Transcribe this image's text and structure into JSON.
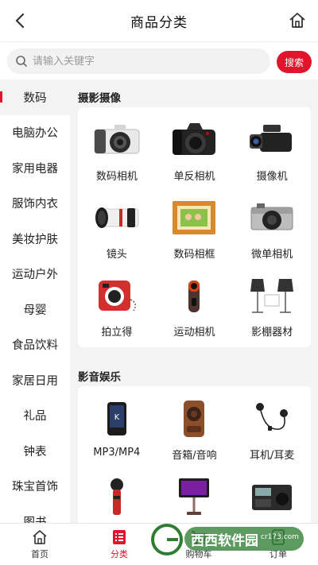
{
  "header": {
    "title": "商品分类"
  },
  "search": {
    "placeholder": "请输入关键字",
    "button": "搜索"
  },
  "sidebar": {
    "items": [
      {
        "label": "数码",
        "active": true
      },
      {
        "label": "电脑办公"
      },
      {
        "label": "家用电器"
      },
      {
        "label": "服饰内衣"
      },
      {
        "label": "美妆护肤"
      },
      {
        "label": "运动户外"
      },
      {
        "label": "母婴"
      },
      {
        "label": "食品饮料"
      },
      {
        "label": "家居日用"
      },
      {
        "label": "礼品"
      },
      {
        "label": "钟表"
      },
      {
        "label": "珠宝首饰"
      },
      {
        "label": "图书"
      }
    ]
  },
  "sections": [
    {
      "title": "摄影摄像",
      "items": [
        {
          "label": "数码相机",
          "icon": "mirrorless-camera-icon"
        },
        {
          "label": "单反相机",
          "icon": "dslr-camera-icon"
        },
        {
          "label": "摄像机",
          "icon": "camcorder-icon"
        },
        {
          "label": "镜头",
          "icon": "lens-icon"
        },
        {
          "label": "数码相框",
          "icon": "photo-frame-icon"
        },
        {
          "label": "微单相机",
          "icon": "micro-camera-icon"
        },
        {
          "label": "拍立得",
          "icon": "instant-camera-icon"
        },
        {
          "label": "运动相机",
          "icon": "action-camera-icon"
        },
        {
          "label": "影棚器材",
          "icon": "studio-light-icon"
        }
      ]
    },
    {
      "title": "影音娱乐",
      "items": [
        {
          "label": "MP3/MP4",
          "icon": "mp3-player-icon"
        },
        {
          "label": "音箱/音响",
          "icon": "speaker-icon"
        },
        {
          "label": "耳机/耳麦",
          "icon": "earphones-icon"
        },
        {
          "label": "",
          "icon": "microphone-icon"
        },
        {
          "label": "",
          "icon": "karaoke-machine-icon"
        },
        {
          "label": "",
          "icon": "radio-icon"
        }
      ]
    }
  ],
  "tabbar": {
    "items": [
      {
        "label": "首页",
        "icon": "home-icon"
      },
      {
        "label": "分类",
        "icon": "category-icon",
        "active": true
      },
      {
        "label": "购物车",
        "icon": "cart-icon"
      },
      {
        "label": "订单",
        "icon": "order-icon"
      }
    ]
  },
  "watermark": {
    "text": "西西软件园",
    "url": "cr173.com"
  },
  "colors": {
    "accent": "#e0142c",
    "panel": "#f3f3f3"
  }
}
